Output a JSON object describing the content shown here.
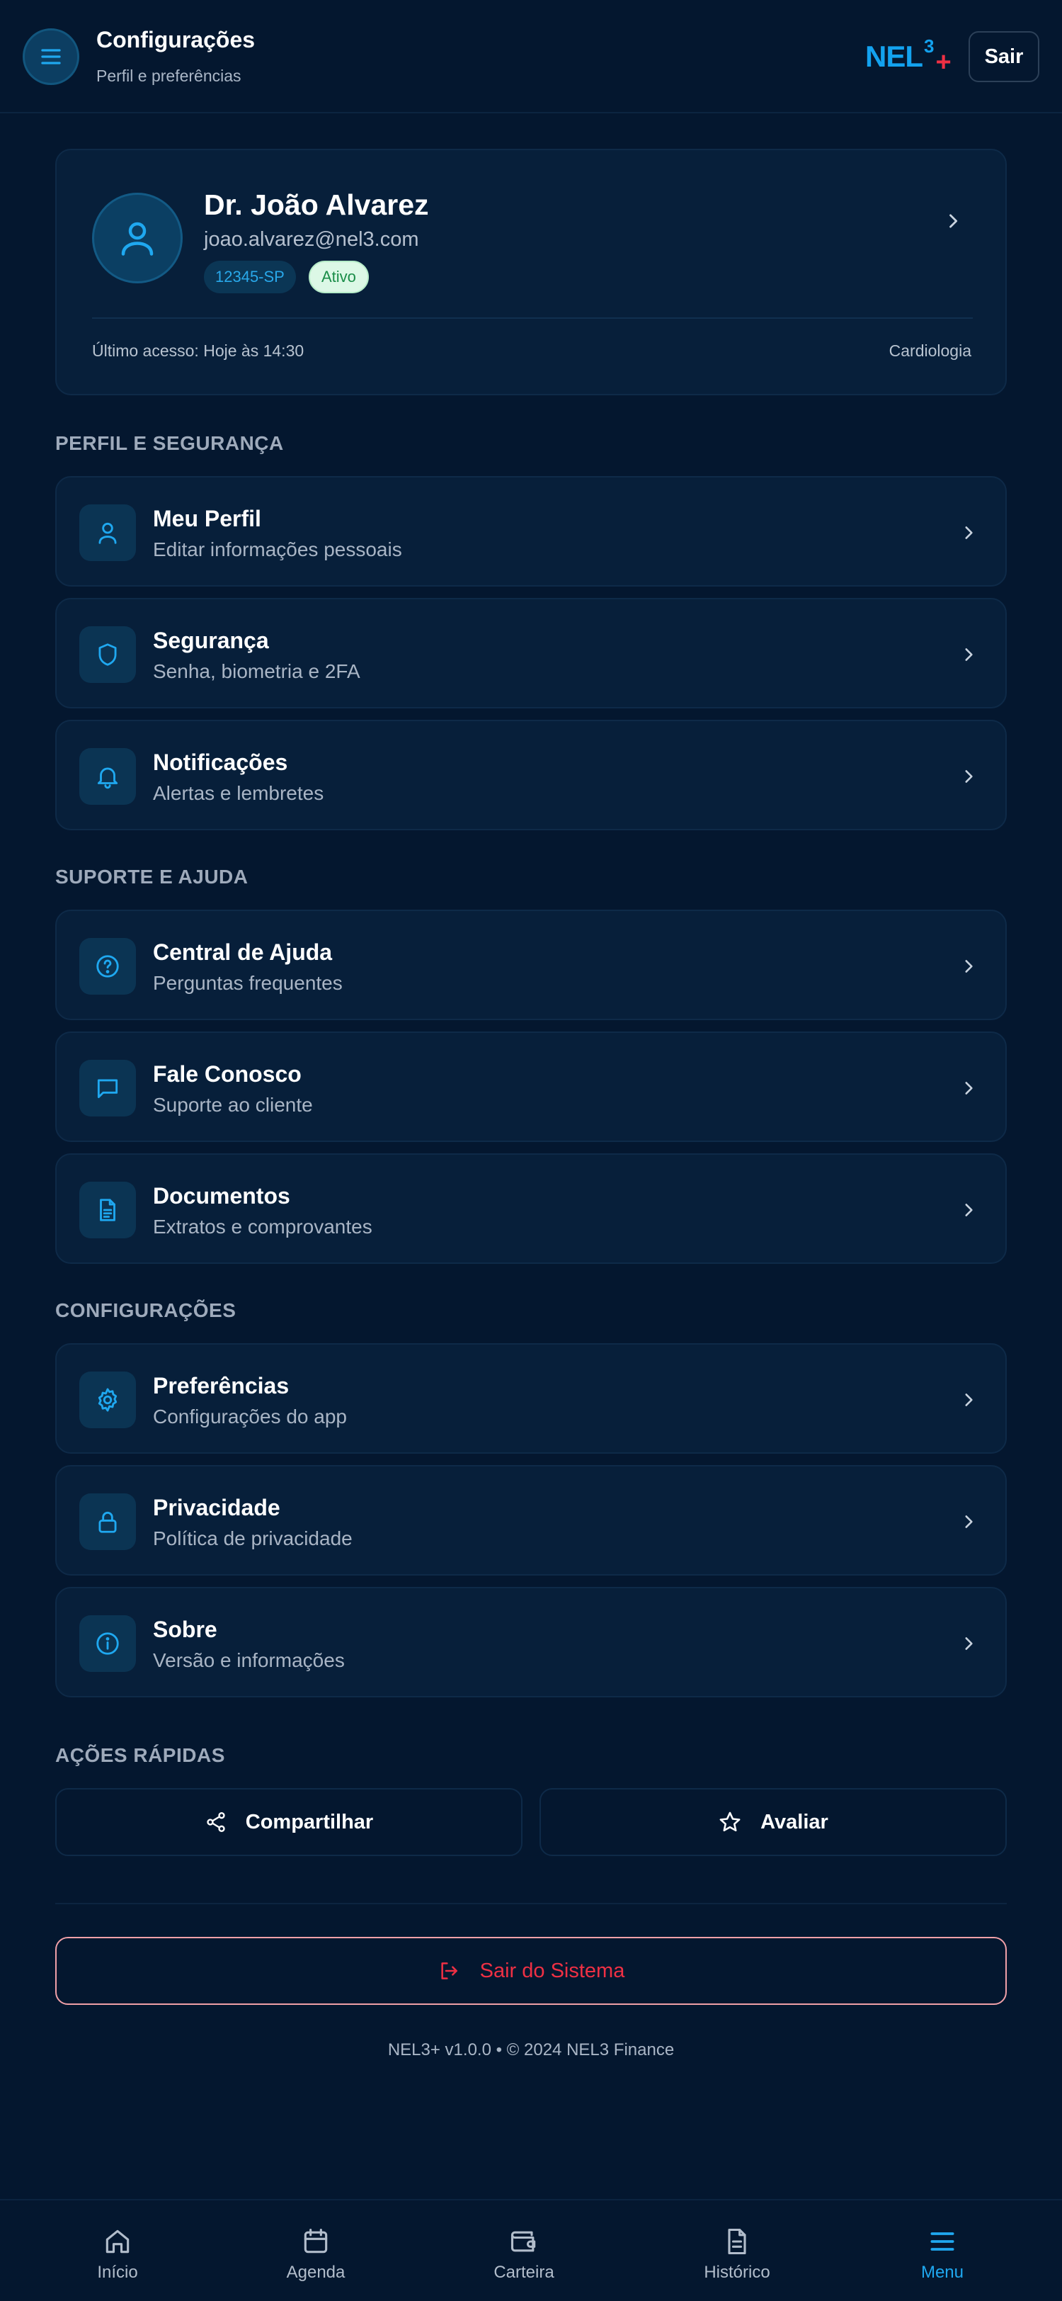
{
  "header": {
    "title": "Configurações",
    "subtitle": "Perfil e preferências",
    "logo_text": "NEL",
    "logo_sup": "3",
    "logo_plus": "+",
    "exit_label": "Sair"
  },
  "profile": {
    "name": "Dr. João Alvarez",
    "email": "joao.alvarez@nel3.com",
    "crm": "12345-SP",
    "status": "Ativo",
    "last_access": "Último acesso: Hoje às 14:30",
    "specialty": "Cardiologia"
  },
  "sections": [
    {
      "title": "PERFIL E SEGURANÇA",
      "items": [
        {
          "title": "Meu Perfil",
          "subtitle": "Editar informações pessoais",
          "icon": "user-icon"
        },
        {
          "title": "Segurança",
          "subtitle": "Senha, biometria e 2FA",
          "icon": "shield-icon"
        },
        {
          "title": "Notificações",
          "subtitle": "Alertas e lembretes",
          "icon": "bell-icon"
        }
      ]
    },
    {
      "title": "SUPORTE E AJUDA",
      "items": [
        {
          "title": "Central de Ajuda",
          "subtitle": "Perguntas frequentes",
          "icon": "help-circle-icon"
        },
        {
          "title": "Fale Conosco",
          "subtitle": "Suporte ao cliente",
          "icon": "message-icon"
        },
        {
          "title": "Documentos",
          "subtitle": "Extratos e comprovantes",
          "icon": "document-icon"
        }
      ]
    },
    {
      "title": "CONFIGURAÇÕES",
      "items": [
        {
          "title": "Preferências",
          "subtitle": "Configurações do app",
          "icon": "gear-icon"
        },
        {
          "title": "Privacidade",
          "subtitle": "Política de privacidade",
          "icon": "lock-icon"
        },
        {
          "title": "Sobre",
          "subtitle": "Versão e informações",
          "icon": "info-icon"
        }
      ]
    }
  ],
  "quick_actions": {
    "title": "AÇÕES RÁPIDAS",
    "share_label": "Compartilhar",
    "rate_label": "Avaliar"
  },
  "logout_label": "Sair do Sistema",
  "footer": "NEL3+ v1.0.0 • © 2024 NEL3 Finance",
  "bottom_nav": [
    {
      "label": "Início",
      "icon": "home-icon"
    },
    {
      "label": "Agenda",
      "icon": "calendar-icon"
    },
    {
      "label": "Carteira",
      "icon": "wallet-icon"
    },
    {
      "label": "Histórico",
      "icon": "file-icon"
    },
    {
      "label": "Menu",
      "icon": "menu-icon",
      "active": true
    }
  ],
  "colors": {
    "background": "#04172f",
    "card": "#071f3a",
    "accent": "#13a2ef",
    "danger": "#ef3044",
    "success_bg": "#dcf8e6"
  }
}
